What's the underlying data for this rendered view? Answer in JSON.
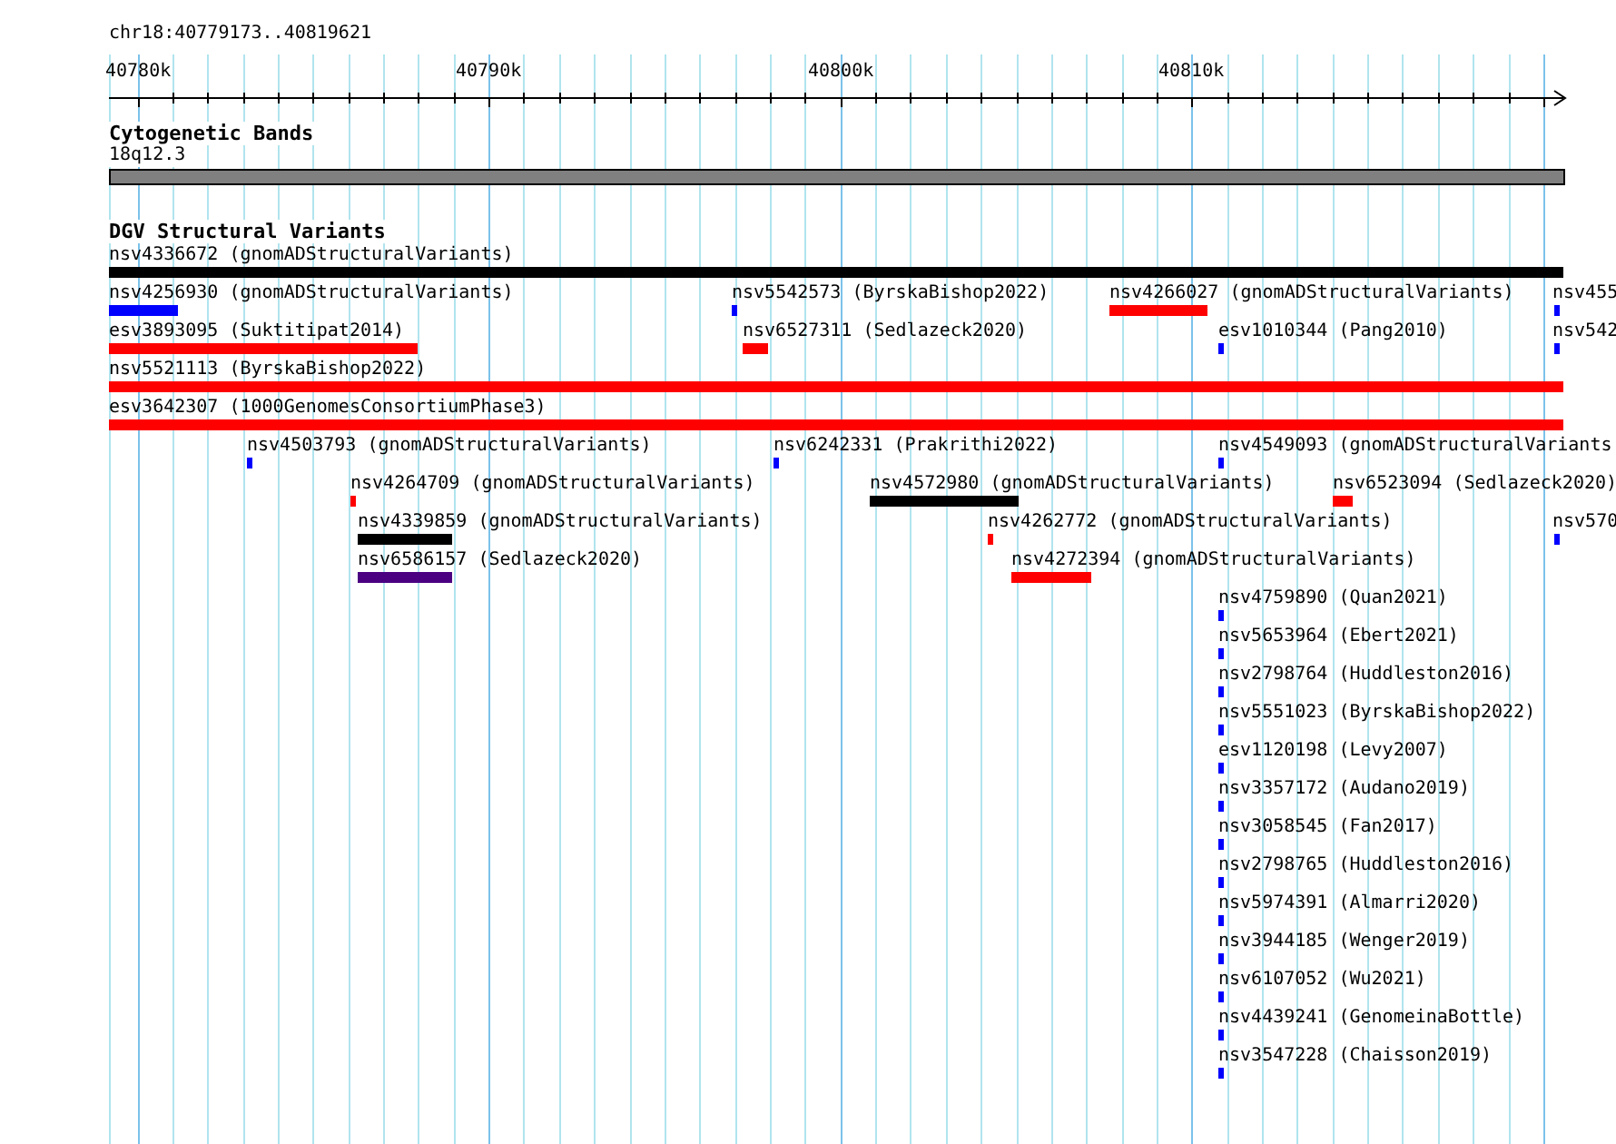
{
  "location": "chr18:40779173..40819621",
  "ruler": {
    "ticks": [
      "40780k",
      "40790k",
      "40800k",
      "40810k"
    ]
  },
  "cytoband_track": {
    "title": "Cytogenetic Bands",
    "band": {
      "label": "18q12.3",
      "color": "#808080"
    }
  },
  "variant_track": {
    "title": "DGV Structural Variants",
    "rows": [
      [
        {
          "label": "nsv4336672 (gnomADStructuralVariants)",
          "color": "#000000"
        }
      ],
      [
        {
          "label": "nsv4256930 (gnomADStructuralVariants)",
          "color": "#0000ff"
        },
        {
          "label": "nsv5542573 (ByrskaBishop2022)",
          "color": "#0000ff"
        },
        {
          "label": "nsv4266027 (gnomADStructuralVariants)",
          "color": "#ff0000"
        },
        {
          "label": "nsv455",
          "color": "#0000ff"
        }
      ],
      [
        {
          "label": "esv3893095 (Suktitipat2014)",
          "color": "#ff0000"
        },
        {
          "label": "nsv6527311 (Sedlazeck2020)",
          "color": "#ff0000"
        },
        {
          "label": "esv1010344 (Pang2010)",
          "color": "#0000ff"
        },
        {
          "label": "nsv542",
          "color": "#0000ff"
        }
      ],
      [
        {
          "label": "nsv5521113 (ByrskaBishop2022)",
          "color": "#ff0000"
        }
      ],
      [
        {
          "label": "esv3642307 (1000GenomesConsortiumPhase3)",
          "color": "#ff0000"
        }
      ],
      [
        {
          "label": "nsv4503793 (gnomADStructuralVariants)",
          "color": "#0000ff"
        },
        {
          "label": "nsv6242331 (Prakrithi2022)",
          "color": "#0000ff"
        },
        {
          "label": "nsv4549093 (gnomADStructuralVariants",
          "color": "#0000ff"
        }
      ],
      [
        {
          "label": "nsv4264709 (gnomADStructuralVariants)",
          "color": "#ff0000"
        },
        {
          "label": "nsv4572980 (gnomADStructuralVariants)",
          "color": "#000000"
        },
        {
          "label": "nsv6523094 (Sedlazeck2020)",
          "color": "#ff0000"
        }
      ],
      [
        {
          "label": "nsv4339859 (gnomADStructuralVariants)",
          "color": "#000000"
        },
        {
          "label": "nsv4262772 (gnomADStructuralVariants)",
          "color": "#ff0000"
        },
        {
          "label": "nsv570",
          "color": "#0000ff"
        }
      ],
      [
        {
          "label": "nsv6586157 (Sedlazeck2020)",
          "color": "#4b0082"
        },
        {
          "label": "nsv4272394 (gnomADStructuralVariants)",
          "color": "#ff0000"
        }
      ],
      [
        {
          "label": "nsv4759890 (Quan2021)",
          "color": "#0000ff"
        }
      ],
      [
        {
          "label": "nsv5653964 (Ebert2021)",
          "color": "#0000ff"
        }
      ],
      [
        {
          "label": "nsv2798764 (Huddleston2016)",
          "color": "#0000ff"
        }
      ],
      [
        {
          "label": "nsv5551023 (ByrskaBishop2022)",
          "color": "#0000ff"
        }
      ],
      [
        {
          "label": "esv1120198 (Levy2007)",
          "color": "#0000ff"
        }
      ],
      [
        {
          "label": "nsv3357172 (Audano2019)",
          "color": "#0000ff"
        }
      ],
      [
        {
          "label": "nsv3058545 (Fan2017)",
          "color": "#0000ff"
        }
      ],
      [
        {
          "label": "nsv2798765 (Huddleston2016)",
          "color": "#0000ff"
        }
      ],
      [
        {
          "label": "nsv5974391 (Almarri2020)",
          "color": "#0000ff"
        }
      ],
      [
        {
          "label": "nsv3944185 (Wenger2019)",
          "color": "#0000ff"
        }
      ],
      [
        {
          "label": "nsv6107052 (Wu2021)",
          "color": "#0000ff"
        }
      ],
      [
        {
          "label": "nsv4439241 (GenomeinaBottle)",
          "color": "#0000ff"
        }
      ],
      [
        {
          "label": "nsv3547228 (Chaisson2019)",
          "color": "#0000ff"
        }
      ]
    ]
  }
}
